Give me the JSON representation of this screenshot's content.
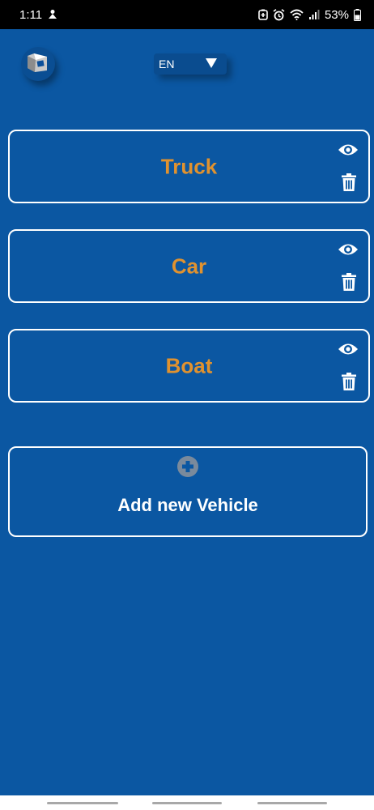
{
  "status_bar": {
    "time": "1:11",
    "battery": "53%",
    "icons": [
      "notification-icon",
      "battery-saver-icon",
      "alarm-icon",
      "wifi-icon",
      "signal-icon",
      "battery-icon"
    ]
  },
  "header": {
    "logo_icon": "app-logo-icon",
    "language": "EN",
    "language_dropdown_icon": "triangle-down-icon"
  },
  "vehicles": [
    {
      "name": "Truck",
      "view_icon": "eye-icon",
      "delete_icon": "trash-icon"
    },
    {
      "name": "Car",
      "view_icon": "eye-icon",
      "delete_icon": "trash-icon"
    },
    {
      "name": "Boat",
      "view_icon": "eye-icon",
      "delete_icon": "trash-icon"
    }
  ],
  "add_vehicle": {
    "label": "Add new Vehicle",
    "icon": "plus-circle-icon"
  },
  "colors": {
    "background": "#0b57a2",
    "vehicle_name": "#e0922f",
    "card_border": "#ffffff"
  }
}
